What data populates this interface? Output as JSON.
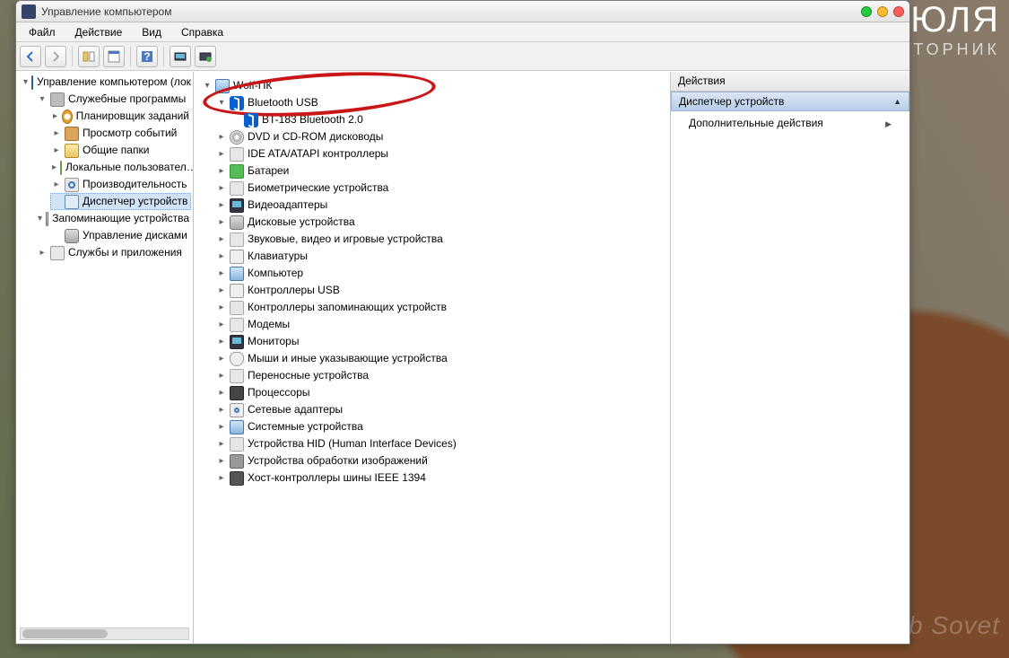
{
  "desktop": {
    "month": "ИЮЛЯ",
    "day": "ВТОРНИК"
  },
  "window": {
    "title": "Управление компьютером",
    "menu": {
      "file": "Файл",
      "action": "Действие",
      "view": "Вид",
      "help": "Справка"
    }
  },
  "left_tree": {
    "root": "Управление компьютером (лок",
    "g1": "Служебные программы",
    "g1_items": {
      "scheduler": "Планировщик заданий",
      "eventviewer": "Просмотр событий",
      "sharedfolders": "Общие папки",
      "localusers": "Локальные пользовател…",
      "performance": "Производительность",
      "devicemgr": "Диспетчер устройств"
    },
    "g2": "Запоминающие устройства",
    "g2_items": {
      "diskmgmt": "Управление дисками"
    },
    "g3": "Службы и приложения"
  },
  "center_tree": {
    "root": "Wolf-ПК",
    "bt_root": "Bluetooth USB",
    "bt_child": "BT-183 Bluetooth 2.0",
    "c1": "DVD и CD-ROM дисководы",
    "c2": "IDE ATA/ATAPI контроллеры",
    "c3": "Батареи",
    "c4": "Биометрические устройства",
    "c5": "Видеоадаптеры",
    "c6": "Дисковые устройства",
    "c7": "Звуковые, видео и игровые устройства",
    "c8": "Клавиатуры",
    "c9": "Компьютер",
    "c10": "Контроллеры USB",
    "c11": "Контроллеры запоминающих устройств",
    "c12": "Модемы",
    "c13": "Мониторы",
    "c14": "Мыши и иные указывающие устройства",
    "c15": "Переносные устройства",
    "c16": "Процессоры",
    "c17": "Сетевые адаптеры",
    "c18": "Системные устройства",
    "c19": "Устройства HID (Human Interface Devices)",
    "c20": "Устройства обработки изображений",
    "c21": "Хост-контроллеры шины IEEE 1394"
  },
  "actions": {
    "header": "Действия",
    "title": "Диспетчер устройств",
    "more": "Дополнительные действия"
  },
  "watermark": "club Sovet"
}
